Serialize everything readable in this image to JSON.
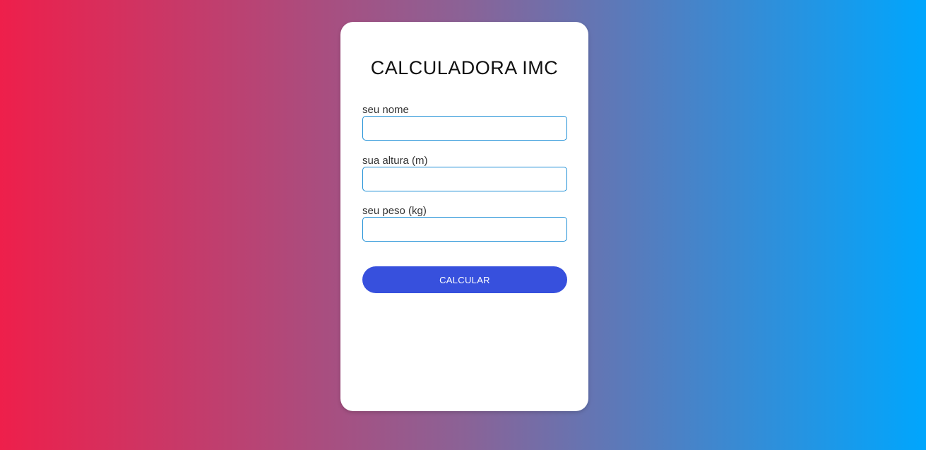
{
  "app": {
    "title": "CALCULADORA IMC"
  },
  "form": {
    "name_label": "seu nome",
    "name_value": "",
    "height_label": "sua altura (m)",
    "height_value": "",
    "weight_label": "seu peso (kg)",
    "weight_value": "",
    "submit_label": "CALCULAR"
  },
  "colors": {
    "gradient_start": "#ee1f4b",
    "gradient_end": "#00a6fd",
    "button": "#3750dd",
    "input_border": "#1e8fd6"
  }
}
